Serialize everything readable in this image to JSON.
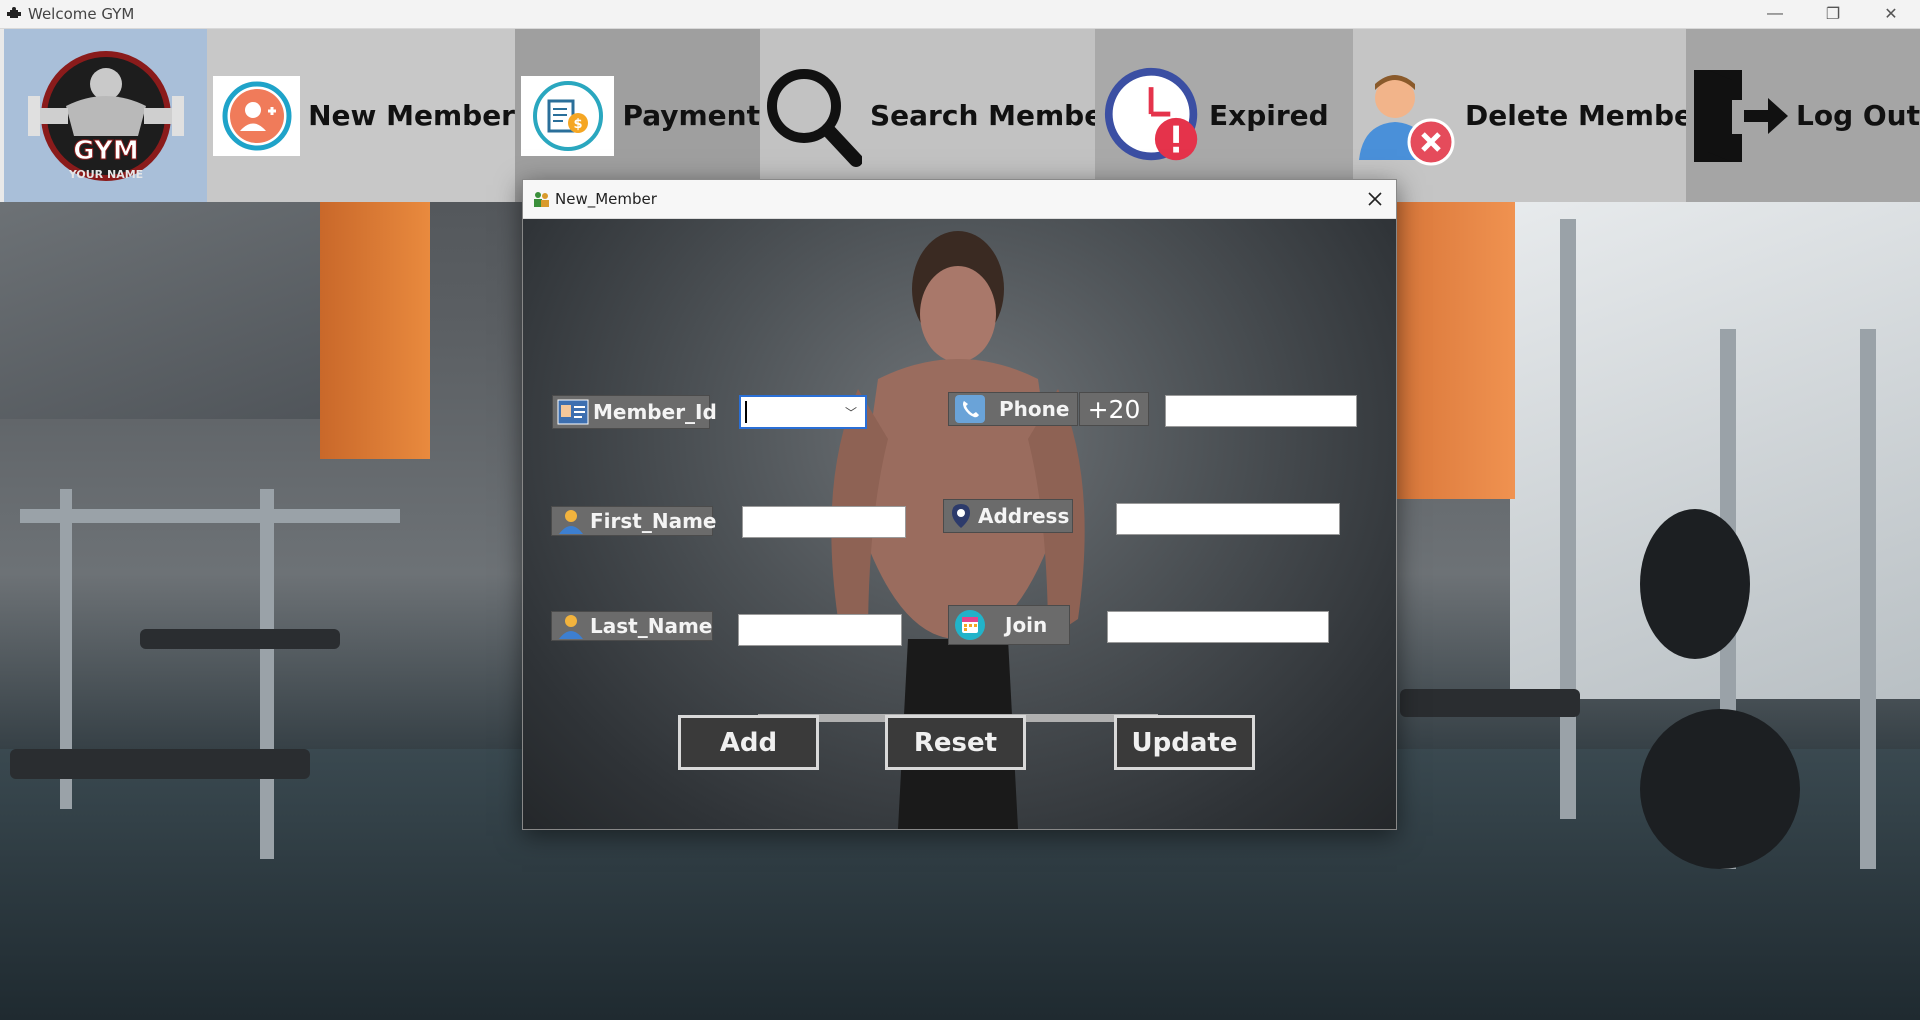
{
  "window": {
    "title": "Welcome GYM",
    "controls": {
      "minimize": "—",
      "restore": "❐",
      "close": "✕"
    }
  },
  "toolbar": {
    "logo": {
      "line1": "GYM",
      "line2": "YOUR NAME"
    },
    "items": [
      {
        "label": "New Member",
        "icon": "add-user-icon"
      },
      {
        "label": "Payment",
        "icon": "payment-icon"
      },
      {
        "label": "Search Member",
        "icon": "search-icon"
      },
      {
        "label": "Expired",
        "icon": "clock-alert-icon"
      },
      {
        "label": "Delete Member",
        "icon": "remove-user-icon"
      },
      {
        "label": "Log Out",
        "icon": "logout-door-icon"
      }
    ]
  },
  "dialog": {
    "title": "New_Member",
    "fields": {
      "member_id": {
        "label": "Member_Id",
        "value": ""
      },
      "phone": {
        "label": "Phone",
        "prefix": "+20",
        "value": ""
      },
      "first_name": {
        "label": "First_Name",
        "value": ""
      },
      "address": {
        "label": "Address",
        "value": ""
      },
      "last_name": {
        "label": "Last_Name",
        "value": ""
      },
      "join": {
        "label": "Join",
        "value": ""
      }
    },
    "buttons": {
      "add": "Add",
      "reset": "Reset",
      "update": "Update"
    }
  },
  "colors": {
    "toolbar_logo_bg": "#a9bfd9",
    "focus_border": "#2a6fd6",
    "label_bg": "#6b6b6b",
    "button_bg": "#3a3a3a"
  }
}
